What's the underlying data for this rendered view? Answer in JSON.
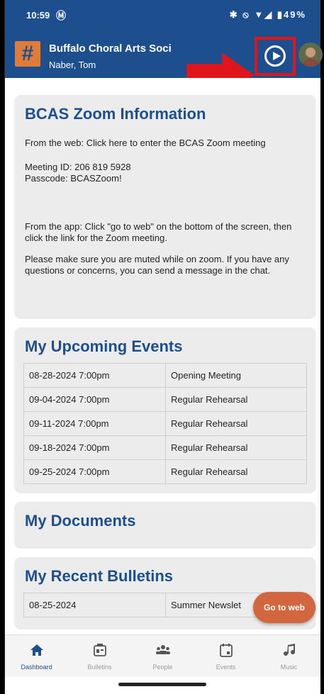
{
  "status_bar": {
    "time": "10:59",
    "right_icons": "✱ ⦸ ▼◢ ▮49%"
  },
  "app_bar": {
    "title": "Buffalo Choral Arts Soci",
    "user": "Naber, Tom",
    "logo_glyph": "#"
  },
  "zoom_card": {
    "title": "BCAS Zoom Information",
    "web_line": "From the web: Click here to enter the BCAS Zoom meeting",
    "meeting_id": "Meeting ID: 206 819 5928",
    "passcode": "Passcode: BCASZoom!",
    "app_line": "From the app: Click \"go to web\" on the bottom of the screen, then click the link for the Zoom meeting.",
    "mute_line": "Please make sure you are muted while on zoom. If you have any questions or concerns, you can send a message in the chat."
  },
  "events_card": {
    "title": "My Upcoming Events",
    "rows": [
      {
        "date": "08-28-2024 7:00pm",
        "name": "Opening Meeting"
      },
      {
        "date": "09-04-2024 7:00pm",
        "name": "Regular Rehearsal"
      },
      {
        "date": "09-11-2024 7:00pm",
        "name": "Regular Rehearsal"
      },
      {
        "date": "09-18-2024 7:00pm",
        "name": "Regular Rehearsal"
      },
      {
        "date": "09-25-2024 7:00pm",
        "name": "Regular Rehearsal"
      }
    ]
  },
  "documents_card": {
    "title": "My Documents"
  },
  "bulletins_card": {
    "title": "My Recent Bulletins",
    "rows": [
      {
        "date": "08-25-2024",
        "name": "Summer Newslet"
      }
    ]
  },
  "go_to_web": "Go to web",
  "nav": [
    {
      "label": "Dashboard",
      "icon": "home-icon",
      "active": true
    },
    {
      "label": "Bulletins",
      "icon": "bulletin-icon",
      "active": false
    },
    {
      "label": "People",
      "icon": "people-icon",
      "active": false
    },
    {
      "label": "Events",
      "icon": "calendar-icon",
      "active": false
    },
    {
      "label": "Music",
      "icon": "music-note-icon",
      "active": false
    }
  ],
  "colors": {
    "brand_blue": "#1d4f8f",
    "accent_orange": "#d2673f",
    "highlight_red": "#e0141b"
  }
}
